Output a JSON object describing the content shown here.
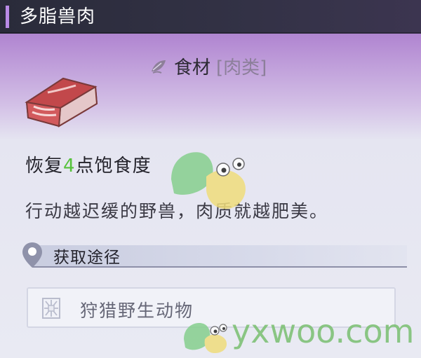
{
  "item": {
    "name": "多脂兽肉",
    "category_label": "食材",
    "category_sub": "[肉类]",
    "effect_prefix": "恢复",
    "effect_value": "4",
    "effect_suffix": "点饱食度",
    "description": "行动越迟缓的野兽，肉质就越肥美。"
  },
  "source": {
    "heading": "获取途径",
    "methods": [
      {
        "label": "狩猎野生动物",
        "icon": "hunting-icon"
      }
    ]
  },
  "watermark": {
    "text": "yxwoo.com"
  },
  "colors": {
    "accent": "#b98ae6",
    "effect_value": "#55c23a",
    "title_bar": "#2a2b3a"
  },
  "icons": [
    "leaf-icon",
    "meat-icon",
    "location-pin-icon",
    "hunting-icon"
  ]
}
